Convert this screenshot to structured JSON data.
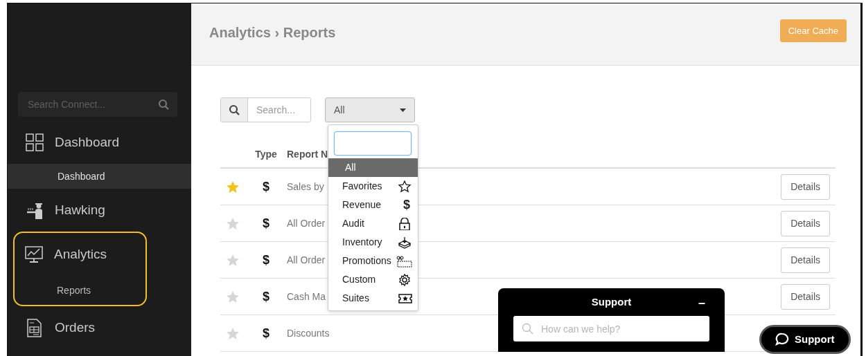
{
  "sidebar": {
    "search": {
      "placeholder": "Search Connect..."
    },
    "items": [
      {
        "label": "Dashboard",
        "children": [
          {
            "label": "Dashboard",
            "selected": true
          }
        ]
      },
      {
        "label": "Hawking"
      },
      {
        "label": "Analytics",
        "highlighted": true,
        "children": [
          {
            "label": "Reports",
            "selected": false
          }
        ]
      },
      {
        "label": "Orders"
      }
    ]
  },
  "header": {
    "breadcrumb": "Analytics › Reports",
    "clear_button": "Clear Cache"
  },
  "filters": {
    "search": {
      "placeholder": "Search..."
    },
    "dropdown": {
      "value": "All",
      "open": true,
      "options": [
        {
          "label": "All",
          "selected": true
        },
        {
          "label": "Favorites",
          "selected": false
        },
        {
          "label": "Revenue",
          "selected": false,
          "symbol": "$"
        },
        {
          "label": "Audit",
          "selected": false
        },
        {
          "label": "Inventory",
          "selected": false
        },
        {
          "label": "Promotions",
          "selected": false
        },
        {
          "label": "Custom",
          "selected": false
        },
        {
          "label": "Suites",
          "selected": false
        }
      ]
    }
  },
  "table": {
    "columns": [
      "Type",
      "Report N"
    ],
    "rows": [
      {
        "favorite": true,
        "type": "$",
        "name": "Sales by",
        "action": "Details"
      },
      {
        "favorite": false,
        "type": "$",
        "name": "All Order",
        "action": "Details"
      },
      {
        "favorite": false,
        "type": "$",
        "name": "All Order",
        "action": "Details"
      },
      {
        "favorite": false,
        "type": "$",
        "name": "Cash Ma",
        "action": "Details"
      },
      {
        "favorite": false,
        "type": "$",
        "name": "Discounts"
      }
    ]
  },
  "support_widget": {
    "title": "Support",
    "minimize": "–",
    "search": {
      "placeholder": "How can we help?"
    }
  },
  "support_button": {
    "label": "Support"
  }
}
